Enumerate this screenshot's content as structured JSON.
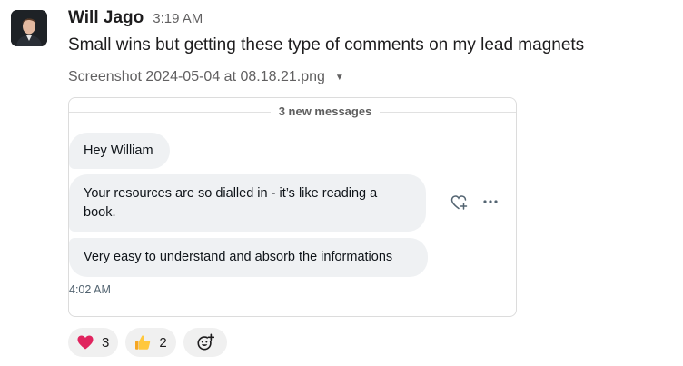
{
  "message": {
    "author": "Will Jago",
    "time": "3:19 AM",
    "text": "Small wins but getting these type of comments on my lead magnets",
    "file_name": "Screenshot 2024-05-04 at 08.18.21.png"
  },
  "attachment": {
    "divider_label": "3 new messages",
    "bubbles": [
      "Hey William",
      "Your resources are so dialled in - it’s like reading a book.",
      "Very easy to understand and absorb the informations"
    ],
    "timestamp": "4:02 AM"
  },
  "reactions": [
    {
      "icon": "red-heart-icon",
      "count": "3"
    },
    {
      "icon": "thumbs-up-icon",
      "count": "2"
    }
  ],
  "colors": {
    "bubble_bg": "#eff1f3",
    "heart": "#e0245e",
    "thumbs": "#ffc83d"
  }
}
